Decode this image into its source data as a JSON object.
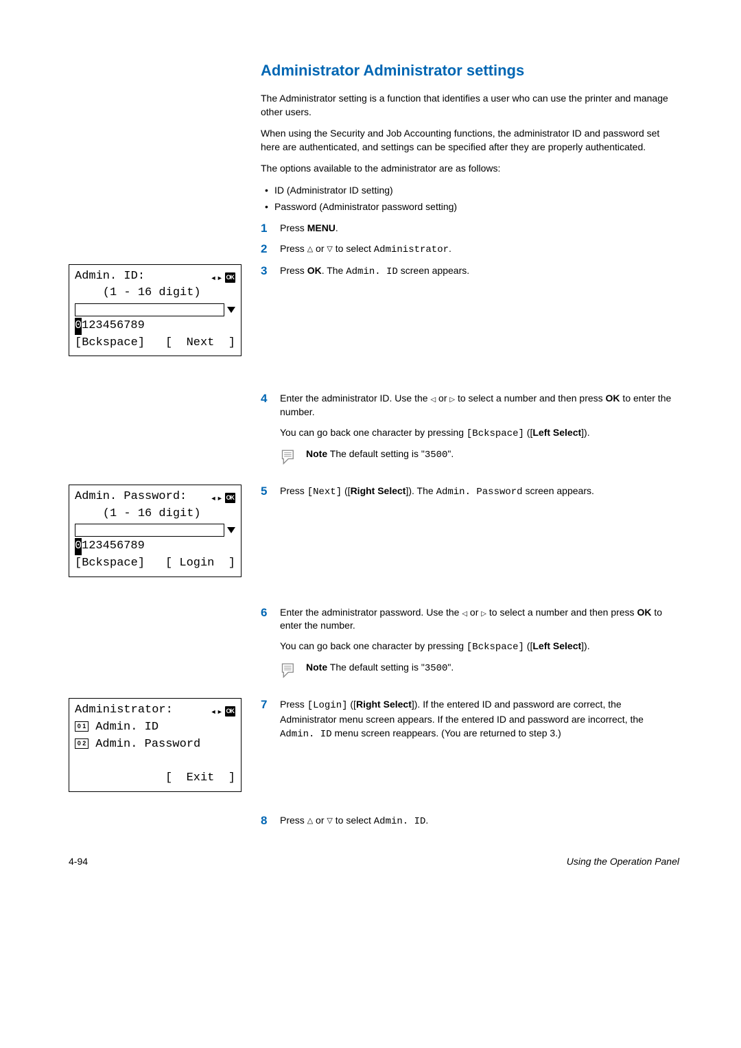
{
  "title": "Administrator Administrator settings",
  "intro1": "The Administrator setting is a function that identifies a user who can use the printer and manage other users.",
  "intro2": "When using the Security and Job Accounting functions, the administrator ID and password set here are authenticated, and settings can be specified after they are properly authenticated.",
  "intro3": "The options available to the administrator are as follows:",
  "bullets": [
    "ID (Administrator ID setting)",
    "Password (Administrator password setting)"
  ],
  "steps": {
    "s1_pre": "Press ",
    "s1_menu": "MENU",
    "s1_post": ".",
    "s2_pre": "Press ",
    "s2_mid": " or ",
    "s2_end": " to select ",
    "s2_target": "Administrator",
    "s2_dot": ".",
    "s3_pre": "Press ",
    "s3_ok": "OK",
    "s3_mid": ". The ",
    "s3_screen": "Admin. ID",
    "s3_end": " screen appears.",
    "s4_a_pre": "Enter the administrator ID. Use the ",
    "s4_a_mid": " or ",
    "s4_a_end": " to select a number and then press ",
    "s4_a_ok": "OK",
    "s4_a_end2": " to enter the number.",
    "s4_b_pre": "You can go back one character by pressing ",
    "s4_b_bck": "[Bckspace]",
    "s4_b_paren": " ([",
    "s4_b_left": "Left Select",
    "s4_b_close": "]).",
    "s4_note_pre": "Note",
    "s4_note_mid": "  The default setting is \"",
    "s4_note_val": "3500",
    "s4_note_end": "\".",
    "s5_pre": "Press ",
    "s5_next": "[Next]",
    "s5_paren": " ([",
    "s5_rs": "Right Select",
    "s5_mid": "]). The ",
    "s5_screen": "Admin. Password",
    "s5_end": " screen appears.",
    "s6_a_pre": "Enter the administrator password. Use the ",
    "s6_a_mid": " or ",
    "s6_a_end": " to select a number and then press ",
    "s6_a_ok": "OK",
    "s6_a_end2": " to enter the number.",
    "s6_b_pre": "You can go back one character by pressing ",
    "s6_b_bck": "[Bckspace]",
    "s6_b_paren": " ([",
    "s6_b_left": "Left Select",
    "s6_b_close": "]).",
    "s6_note_pre": "Note",
    "s6_note_mid": "  The default setting is \"",
    "s6_note_val": "3500",
    "s6_note_end": "\".",
    "s7_a_pre": "Press ",
    "s7_a_login": "[Login]",
    "s7_a_paren": " ([",
    "s7_a_rs": "Right Select",
    "s7_a_end": "]). If the entered ID and password are correct, the Administrator menu screen appears. If the entered ID and password are incorrect, the ",
    "s7_a_screen": "Admin. ID",
    "s7_a_end2": " menu screen reappears. (You are returned to step 3.)",
    "s8_pre": "Press ",
    "s8_mid": " or ",
    "s8_end": " to select ",
    "s8_target": "Admin. ID",
    "s8_dot": "."
  },
  "lcd1": {
    "title": "Admin. ID:",
    "range": "    (1 - 16 digit)",
    "chars": "0123456789",
    "soft_left": "[Bckspace]",
    "soft_right": "[  Next  ]"
  },
  "lcd2": {
    "title": "Admin. Password:",
    "range": "    (1 - 16 digit)",
    "chars": "0123456789",
    "soft_left": "[Bckspace]",
    "soft_right": "[ Login  ]"
  },
  "lcd3": {
    "title": "Administrator:",
    "item1_num": "0 1",
    "item1": " Admin. ID",
    "item2_num": "0 2",
    "item2": " Admin. Password",
    "soft_right": "[  Exit  ]"
  },
  "footer": {
    "page": "4-94",
    "label": "Using the Operation Panel"
  }
}
